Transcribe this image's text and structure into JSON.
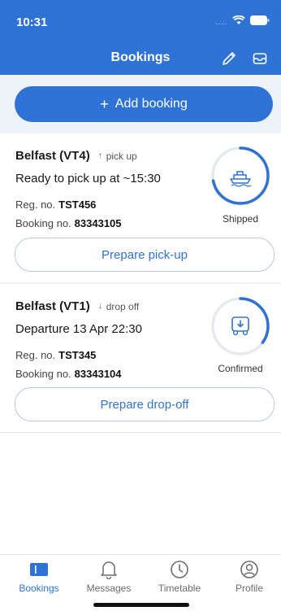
{
  "status_bar": {
    "time": "10:31",
    "dots": "...."
  },
  "header": {
    "title": "Bookings"
  },
  "add_booking": {
    "plus": "+",
    "label": "Add booking"
  },
  "bookings": [
    {
      "route": "Belfast (VT4)",
      "direction_arrow": "↑",
      "direction": "pick up",
      "status_line": "Ready to pick up at ~15:30",
      "reg_label": "Reg. no.",
      "reg_value": "TST456",
      "booking_label": "Booking no.",
      "booking_value": "83343105",
      "status": "Shipped",
      "progress": 0.72,
      "icon": "ship-icon",
      "action": "Prepare pick-up"
    },
    {
      "route": "Belfast (VT1)",
      "direction_arrow": "↓",
      "direction": "drop off",
      "status_line": "Departure 13 Apr 22:30",
      "reg_label": "Reg. no.",
      "reg_value": "TST345",
      "booking_label": "Booking no.",
      "booking_value": "83343104",
      "status": "Confirmed",
      "progress": 0.35,
      "icon": "truck-download-icon",
      "action": "Prepare drop-off"
    }
  ],
  "nav": [
    {
      "label": "Bookings",
      "icon": "ticket-icon",
      "active": true
    },
    {
      "label": "Messages",
      "icon": "bell-icon",
      "active": false
    },
    {
      "label": "Timetable",
      "icon": "clock-icon",
      "active": false
    },
    {
      "label": "Profile",
      "icon": "user-icon",
      "active": false
    }
  ],
  "colors": {
    "brand": "#2f72d6",
    "ring_track": "#e6e9ee",
    "background": "#eef3fa"
  }
}
